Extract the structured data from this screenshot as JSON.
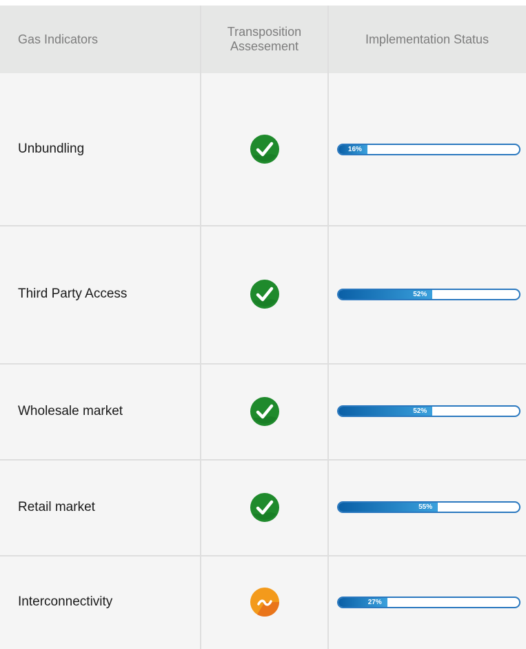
{
  "header": {
    "col1": "Gas Indicators",
    "col2_line1": "Transposition",
    "col2_line2": "Assesement",
    "col3": "Implementation Status"
  },
  "rows": [
    {
      "label": "Unbundling",
      "assessment": "check",
      "status_pct": 16,
      "status_text": "16%"
    },
    {
      "label": "Third Party Access",
      "assessment": "check",
      "status_pct": 52,
      "status_text": "52%"
    },
    {
      "label": "Wholesale market",
      "assessment": "check",
      "status_pct": 52,
      "status_text": "52%"
    },
    {
      "label": "Retail market",
      "assessment": "check",
      "status_pct": 55,
      "status_text": "55%"
    },
    {
      "label": "Interconnectivity",
      "assessment": "partial",
      "status_pct": 27,
      "status_text": "27%"
    }
  ],
  "colors": {
    "check": "#1f8a2c",
    "partial": "#f39a1b",
    "bar_fill": "#1d74bd"
  },
  "chart_data": {
    "type": "table",
    "columns": [
      "Gas Indicators",
      "Transposition Assesement",
      "Implementation Status"
    ],
    "categories": [
      "Unbundling",
      "Third Party Access",
      "Wholesale market",
      "Retail market",
      "Interconnectivity"
    ],
    "values": [
      16,
      52,
      52,
      55,
      27
    ],
    "unit": "%",
    "ylim": [
      0,
      100
    ]
  }
}
